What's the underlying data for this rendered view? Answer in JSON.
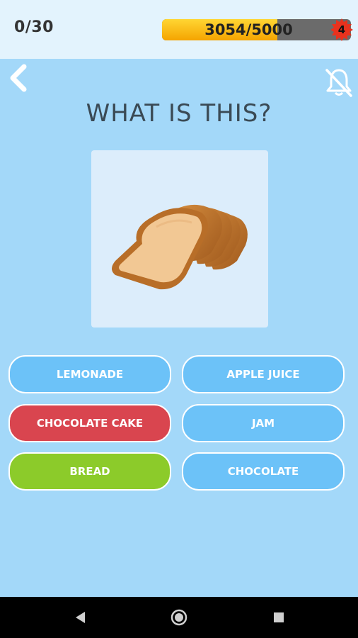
{
  "header": {
    "question_counter": "0/30",
    "xp_text": "3054/5000",
    "xp_progress": 0.61,
    "level": "4"
  },
  "question": {
    "title": "WHAT IS THIS?",
    "image_subject": "sliced bread loaf"
  },
  "answers": [
    {
      "label": "LEMONADE",
      "state": "default"
    },
    {
      "label": "APPLE JUICE",
      "state": "default"
    },
    {
      "label": "CHOCOLATE CAKE",
      "state": "wrong"
    },
    {
      "label": "JAM",
      "state": "default"
    },
    {
      "label": "BREAD",
      "state": "correct"
    },
    {
      "label": "CHOCOLATE",
      "state": "default"
    }
  ],
  "icons": {
    "back": "chevron-left-icon",
    "mute": "bell-muted-icon",
    "nav_back": "triangle-back-icon",
    "nav_home": "circle-home-icon",
    "nav_recents": "square-recents-icon"
  },
  "colors": {
    "background": "#a3d8f9",
    "answer_default": "#6cc2f8",
    "answer_wrong": "#d9454f",
    "answer_correct": "#8ccb2a",
    "xp_fill": "#f5a400"
  }
}
